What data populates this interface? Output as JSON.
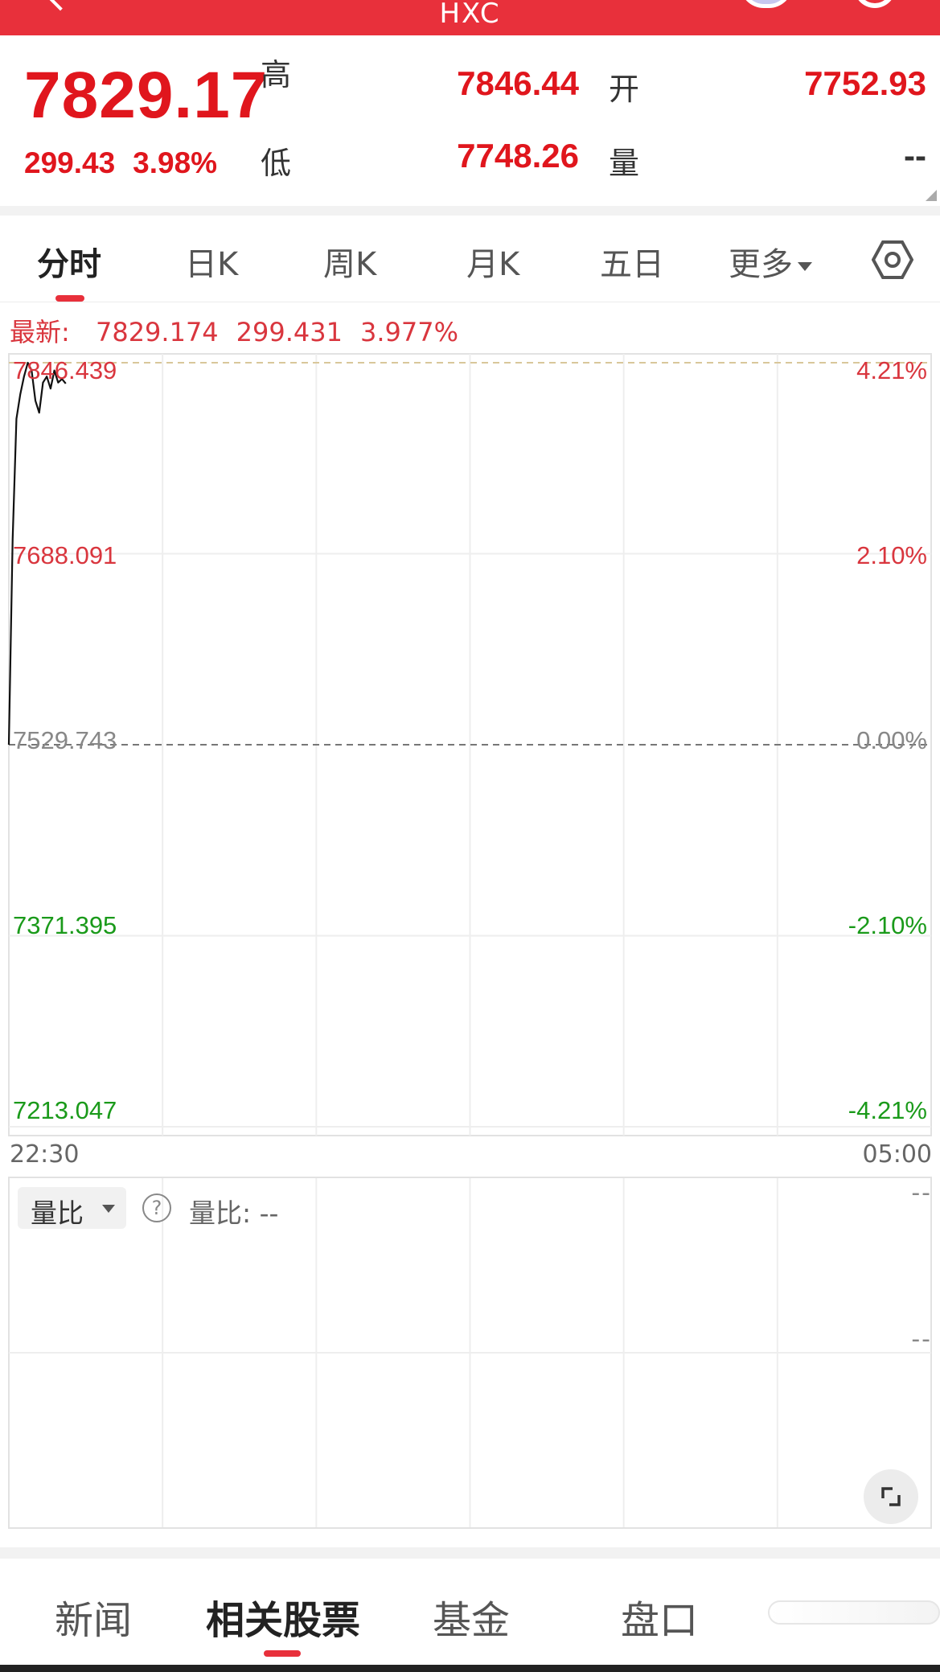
{
  "header": {
    "title": "HXC"
  },
  "quote": {
    "price": "7829.17",
    "change": "299.43",
    "change_pct": "3.98%",
    "high_label": "高",
    "high_value": "7846.44",
    "open_label": "开",
    "open_value": "7752.93",
    "low_label": "低",
    "low_value": "7748.26",
    "volume_label": "量",
    "volume_value": "--"
  },
  "tabs": [
    "分时",
    "日K",
    "周K",
    "月K",
    "五日",
    "更多"
  ],
  "active_tab": "分时",
  "chart_header": {
    "latest_label": "最新:",
    "latest_price": "7829.174",
    "latest_change": "299.431",
    "latest_pct": "3.977%"
  },
  "colors": {
    "brand": "#e8303b",
    "up": "#d9363e",
    "down": "#1a9a1a",
    "flat": "#888888"
  },
  "chart_data": {
    "type": "line",
    "title": "",
    "xlabel": "",
    "ylabel": "",
    "y_ticks": [
      "7846.439",
      "7688.091",
      "7529.743",
      "7371.395",
      "7213.047"
    ],
    "y_pct_ticks": [
      "4.21%",
      "2.10%",
      "0.00%",
      "-2.10%",
      "-4.21%"
    ],
    "x_ticks": [
      "22:30",
      "05:00"
    ],
    "ylim": [
      7213.047,
      7846.439
    ],
    "prev_close": 7529.743,
    "high": 7846.439,
    "series": [
      {
        "values": [
          7529.743,
          7700,
          7800,
          7820,
          7835,
          7846.439,
          7840,
          7815,
          7805,
          7830,
          7835,
          7825,
          7840,
          7830,
          7833,
          7829.174
        ]
      }
    ],
    "total_points": 390,
    "grid": true
  },
  "volume_panel": {
    "select_label": "量比",
    "help_icon": "question-icon",
    "ratio_text": "量比: --",
    "right_top": "--",
    "right_mid": "--"
  },
  "bottom_tabs": [
    "新闻",
    "相关股票",
    "基金",
    "盘口"
  ],
  "active_bottom_tab": "相关股票"
}
